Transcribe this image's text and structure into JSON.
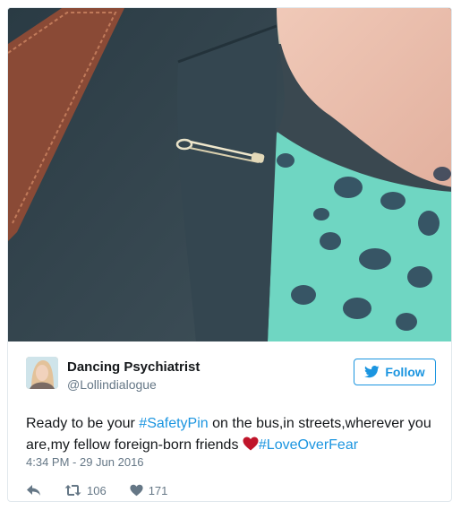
{
  "author": {
    "display_name": "Dancing Psychiatrist",
    "handle": "@Lollindialogue"
  },
  "follow_button": {
    "label": "Follow",
    "icon": "twitter-bird-icon"
  },
  "tweet": {
    "text_part1": "Ready to be your ",
    "hashtag1": "#SafetyPin",
    "text_part2": " on the bus,in streets,wherever you are,my fellow foreign-born friends ",
    "emoji": "red-heart-icon",
    "hashtag2": "#LoveOverFear",
    "timestamp": "4:34 PM - 29 Jun 2016"
  },
  "actions": {
    "reply_icon": "reply-icon",
    "retweet_icon": "retweet-icon",
    "retweet_count": "106",
    "like_icon": "heart-icon",
    "like_count": "171"
  },
  "colors": {
    "link_blue": "#1b95e0",
    "text": "#14171a",
    "secondary": "#657786",
    "heart_red": "#c0152a"
  }
}
